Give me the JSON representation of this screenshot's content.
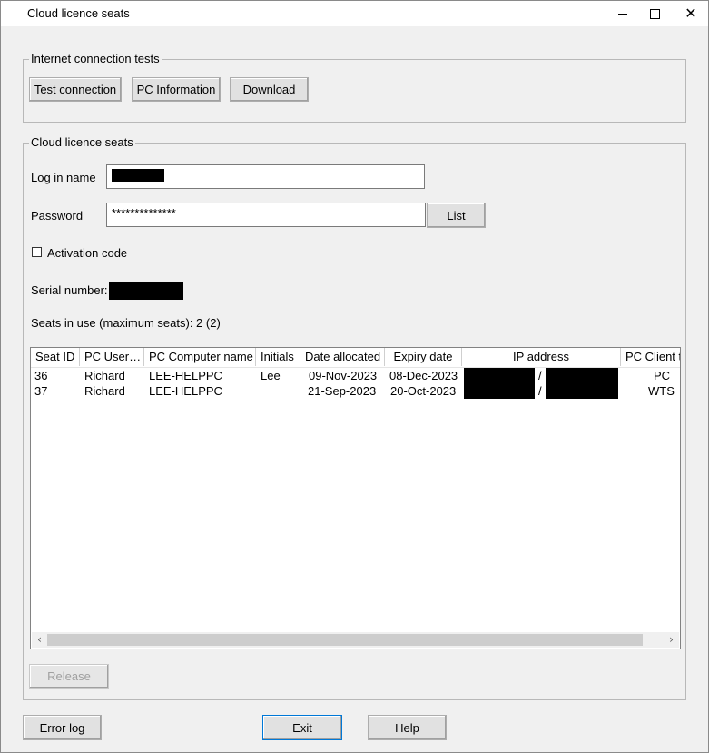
{
  "window": {
    "title": "Cloud licence seats"
  },
  "internet_group": {
    "legend": "Internet connection tests",
    "buttons": {
      "test_connection": "Test connection",
      "pc_information": "PC Information",
      "download": "Download"
    }
  },
  "seats_group": {
    "legend": "Cloud licence seats",
    "login_label": "Log in name",
    "password_label": "Password",
    "password_value": "**************",
    "list_button": "List",
    "activation_label": "Activation code",
    "activation_checked": false,
    "serial_label": "Serial number:",
    "seats_summary": "Seats in use (maximum seats): 2 (2)"
  },
  "table": {
    "columns": [
      "Seat ID",
      "PC User…",
      "PC Computer name",
      "Initials",
      "Date allocated",
      "Expiry date",
      "IP address",
      "PC Client t"
    ],
    "rows": [
      {
        "seat_id": "36",
        "pc_user": "Richard",
        "computer": "LEE-HELPPC",
        "initials": "Lee",
        "allocated": "09-Nov-2023",
        "expiry": "08-Dec-2023",
        "ip_sep": "/",
        "client": "PC"
      },
      {
        "seat_id": "37",
        "pc_user": "Richard",
        "computer": "LEE-HELPPC",
        "initials": "",
        "allocated": "21-Sep-2023",
        "expiry": "20-Oct-2023",
        "ip_sep": "/",
        "client": "WTS"
      }
    ]
  },
  "release_button": "Release",
  "footer": {
    "error_log": "Error log",
    "exit": "Exit",
    "help": "Help"
  },
  "icons": {
    "minimize": "minimize-icon",
    "maximize": "maximize-icon",
    "close": "close-icon",
    "scroll_left": "chevron-left-icon",
    "scroll_right": "chevron-right-icon"
  }
}
